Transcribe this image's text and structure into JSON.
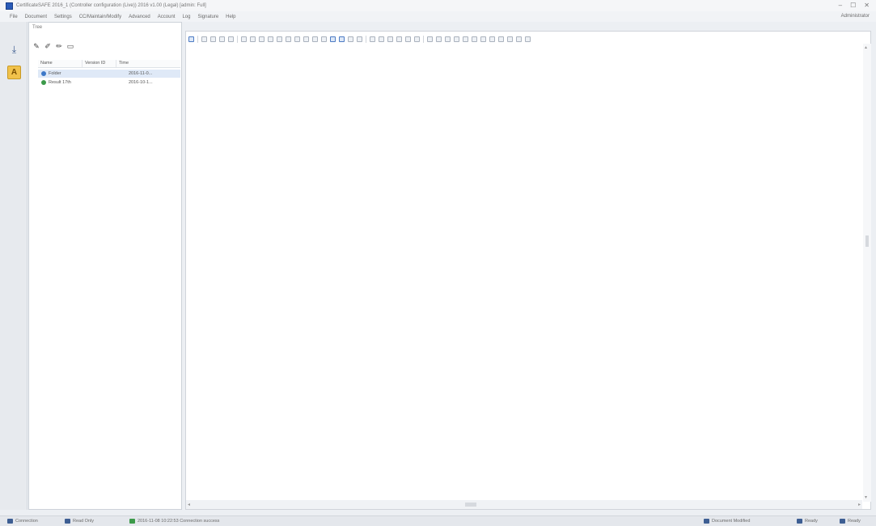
{
  "window": {
    "title": "CertificateSAFE 2016_1 (Controller configuration (Live)) 2016 v1.00 (Legal) [admin: Full]",
    "controls": [
      "–",
      "☐",
      "✕"
    ]
  },
  "menu": {
    "items": [
      "File",
      "Document",
      "Settings",
      "CC/Maintain/Modify",
      "Advanced",
      "Account",
      "Log",
      "Signature",
      "Help"
    ],
    "right_label": "Administrator"
  },
  "left_strip": {
    "download_icon": "download-icon",
    "sign_icon": "signature-icon"
  },
  "tree_panel": {
    "title": "Tree",
    "toolbar_icons": [
      "pen-icon",
      "pen-multi-icon",
      "pen-edit-icon",
      "folder-icon"
    ],
    "columns": [
      "Name",
      "Version ID",
      "Time"
    ],
    "rows": [
      {
        "name": "Folder",
        "version": "",
        "time": "2016-11-0...",
        "color": "#3c78c8"
      },
      {
        "name": "Result 17th",
        "version": "",
        "time": "2016-10-1...",
        "color": "#3c9a4a"
      }
    ]
  },
  "status_bar": {
    "left_1": "Connection",
    "left_2": "Read Only",
    "message": "2016-11-08 10:22:53 Connection success",
    "right_1": "Document Modified",
    "right_2": "Ready",
    "right_3": "Ready"
  },
  "colors": {
    "accent": "#2a5bb8",
    "selection": "#dfe9f7"
  }
}
